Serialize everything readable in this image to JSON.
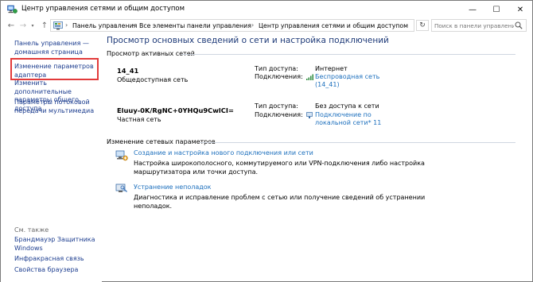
{
  "window": {
    "title": "Центр управления сетями и общим доступом",
    "controls": {
      "minimize": "—",
      "maximize": "☐",
      "close": "✕"
    }
  },
  "addressbar": {
    "back": "←",
    "forward": "→",
    "recent": "▾",
    "up": "↑",
    "breadcrumbs": [
      "Панель управления",
      "Все элементы панели управления",
      "Центр управления сетями и общим доступом"
    ],
    "separator": "›",
    "dropdown": "▾",
    "refresh": "↻",
    "search_placeholder": "Поиск в панели управления"
  },
  "leftpane": {
    "links": [
      "Панель управления —",
      "домашняя страница",
      "Изменение параметров",
      "адаптера",
      "Изменить дополнительные",
      "параметры общего доступа",
      "Параметры потоковой",
      "передачи мультимедиа"
    ],
    "see_also_heading": "См. также",
    "see_also": [
      "Брандмауэр Защитника",
      "Windows",
      "Инфракрасная связь",
      "Свойства браузера"
    ]
  },
  "main": {
    "title": "Просмотр основных сведений о сети и настройка подключений",
    "active_networks_heading": "Просмотр активных сетей",
    "networks": [
      {
        "name": "14_41",
        "type": "Общедоступная сеть",
        "access_label": "Тип доступа:",
        "access_value": "Интернет",
        "connections_label": "Подключения:",
        "connection_line1": "Беспроводная сеть",
        "connection_line2": "(14_41)"
      },
      {
        "name": "Eluuy-0K/RgNC+0YHQu9CwlCI=",
        "type": "Частная сеть",
        "access_label": "Тип доступа:",
        "access_value": "Без доступа к сети",
        "connections_label": "Подключения:",
        "connection_line1": "Подключение по",
        "connection_line2": "локальной сети* 11"
      }
    ],
    "change_settings_heading": "Изменение сетевых параметров",
    "tasks": [
      {
        "link": "Создание и настройка нового подключения или сети",
        "desc_line1": "Настройка широкополосного, коммутируемого или VPN-подключения либо настройка",
        "desc_line2": "маршрутизатора или точки доступа."
      },
      {
        "link": "Устранение неполадок",
        "desc_line1": "Диагностика и исправление проблем с сетью или получение сведений об устранении",
        "desc_line2": "неполадок."
      }
    ]
  },
  "icons": {
    "app": "network-center-icon",
    "control_panel": "control-panel-icon",
    "search": "search-icon",
    "wifi": "wifi-signal-icon",
    "ethernet": "ethernet-icon",
    "new_connection": "new-connection-icon",
    "troubleshoot": "troubleshoot-icon"
  },
  "colors": {
    "link": "#1c6fbd",
    "nav_link": "#1c3d8f",
    "title": "#1e3a78",
    "highlight": "#e23a3a"
  }
}
